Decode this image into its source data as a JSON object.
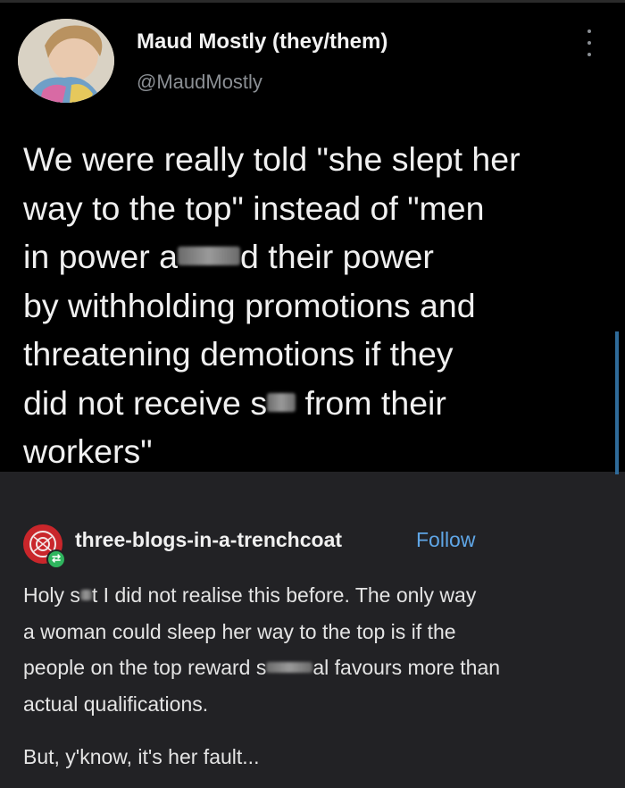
{
  "tweet": {
    "display_name": "Maud Mostly (they/them)",
    "handle": "@MaudMostly",
    "text_lines": [
      "We were really told \"she slept her",
      "way to the top\" instead of \"men",
      "in power a",
      "d their power",
      "by withholding promotions and",
      "threatening demotions if they",
      "did not receive s",
      " from their",
      "workers\""
    ]
  },
  "reblog": {
    "blog_name": "three-blogs-in-a-trenchcoat",
    "follow_label": "Follow",
    "body_parts": [
      "Holy s",
      "t I did not realise this before. The only way",
      "a woman could sleep her way to the top is if the",
      "people on the top reward s",
      "al favours more than",
      "actual qualifications."
    ],
    "closing": "But, y'know, it's her fault..."
  },
  "icons": {
    "avatar": "profile-photo",
    "more": "vertical-ellipsis-icon",
    "blog_avatar": "tumblr-blog-avatar",
    "reblog_badge": "reblog-icon"
  },
  "colors": {
    "tweet_background": "#000000",
    "reblog_background": "#222225",
    "follow_link": "#5fa6e6",
    "reblog_badge": "#2fb55e"
  }
}
